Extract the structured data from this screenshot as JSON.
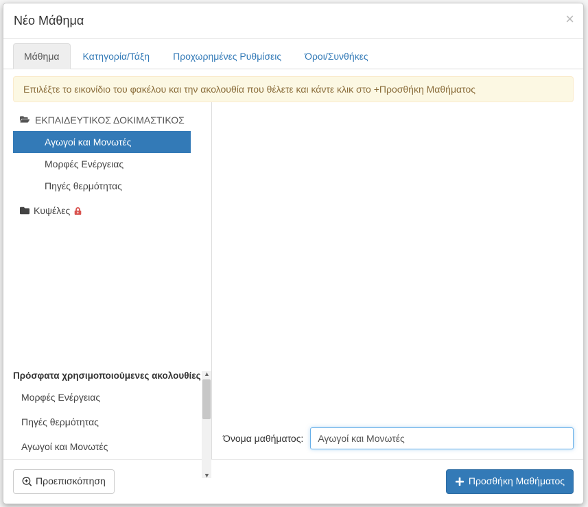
{
  "modal": {
    "title": "Νέο Μάθημα"
  },
  "tabs": [
    {
      "label": "Μάθημα",
      "active": true
    },
    {
      "label": "Κατηγορία/Τάξη",
      "active": false
    },
    {
      "label": "Προχωρημένες Ρυθμίσεις",
      "active": false
    },
    {
      "label": "Όροι/Συνθήκες",
      "active": false
    }
  ],
  "alert": "Επιλέξτε το εικονίδιο του φακέλου και την ακολουθία που θέλετε και κάντε κλικ στο +Προσθήκη Μαθήματος",
  "tree": {
    "root_label": "ΕΚΠΑΙΔΕΥΤΙΚΟΣ ΔΟΚΙΜΑΣΤΙΚΟΣ",
    "items": [
      {
        "label": "Αγωγοί και Μονωτές",
        "selected": true
      },
      {
        "label": "Μορφές Ενέργειας",
        "selected": false
      },
      {
        "label": "Πηγές θερμότητας",
        "selected": false
      }
    ],
    "leaf": {
      "label": "Κυψέλες",
      "locked": true
    }
  },
  "recent": {
    "title": "Πρόσφατα χρησιμοποιούμενες ακολουθίες",
    "items": [
      {
        "label": "Μορφές Ενέργειας"
      },
      {
        "label": "Πηγές θερμότητας"
      },
      {
        "label": "Αγωγοί και Μονωτές"
      }
    ]
  },
  "form": {
    "name_label": "Όνομα μαθήματος:",
    "name_value": "Αγωγοί και Μονωτές"
  },
  "footer": {
    "preview_label": "Προεπισκόπηση",
    "add_label": "Προσθήκη Μαθήματος"
  },
  "colors": {
    "primary": "#337ab7",
    "warning_bg": "#fcf8e3",
    "danger": "#d9534f"
  }
}
